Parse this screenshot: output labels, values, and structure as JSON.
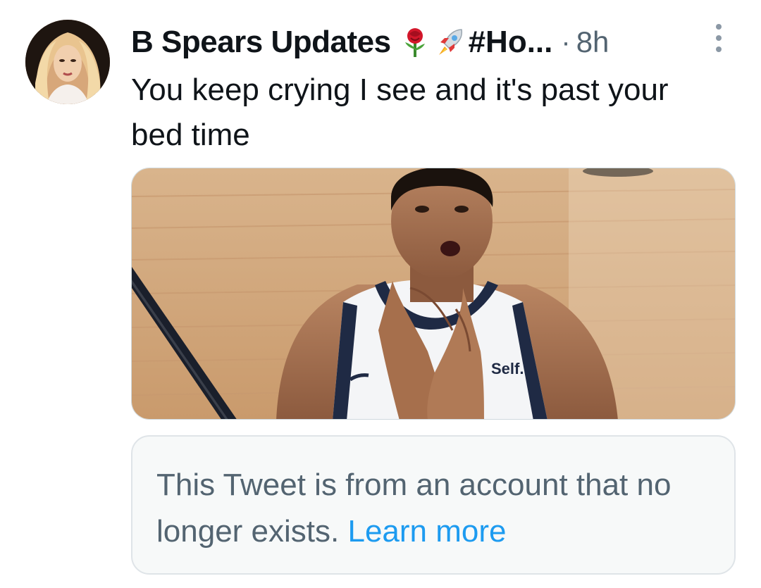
{
  "author": {
    "display_name": "B Spears Updates",
    "emojis": [
      "rose-emoji",
      "rocket-emoji"
    ],
    "name_suffix": "#Ho...",
    "separator": "·",
    "timestamp": "8h"
  },
  "tweet": {
    "text": "You keep crying I see and it's past your bed time",
    "media": {
      "jersey_text": "Self."
    }
  },
  "notice": {
    "message": "This Tweet is from an account that no longer exists.",
    "link_label": "Learn more"
  },
  "colors": {
    "text_primary": "#0f1419",
    "text_secondary": "#536471",
    "link": "#1d9bf0",
    "notice_bg": "#f7f9f9",
    "border": "#cfd9de"
  }
}
